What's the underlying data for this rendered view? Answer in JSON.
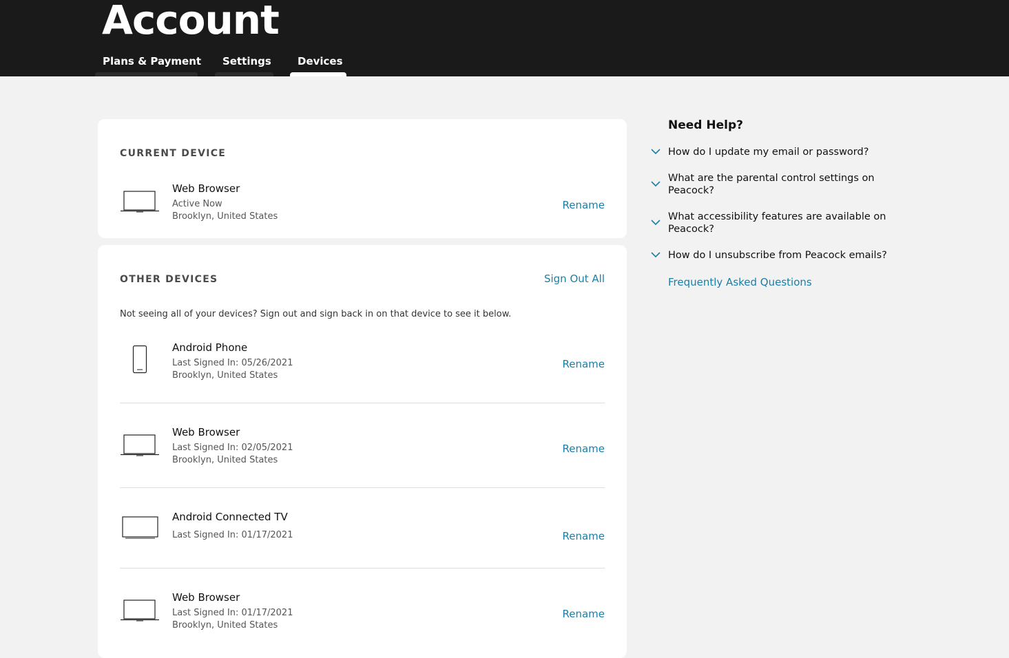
{
  "header": {
    "title": "Account",
    "tabs": [
      {
        "label": "Plans & Payment"
      },
      {
        "label": "Settings"
      },
      {
        "label": "Devices"
      }
    ]
  },
  "current_device": {
    "section_title": "CURRENT DEVICE",
    "device": {
      "name": "Web Browser",
      "status": "Active Now",
      "location": "Brooklyn, United States",
      "icon": "laptop-icon"
    },
    "rename_label": "Rename"
  },
  "other_devices": {
    "section_title": "OTHER DEVICES",
    "sign_out_all_label": "Sign Out All",
    "notice": "Not seeing all of your devices? Sign out and sign back in on that device to see it below.",
    "rename_label": "Rename",
    "devices": [
      {
        "name": "Android Phone",
        "status": "Last Signed In: 05/26/2021",
        "location": "Brooklyn, United States",
        "icon": "phone-icon"
      },
      {
        "name": "Web Browser",
        "status": "Last Signed In: 02/05/2021",
        "location": "Brooklyn, United States",
        "icon": "laptop-icon"
      },
      {
        "name": "Android Connected TV",
        "status": "Last Signed In: 01/17/2021",
        "location": "",
        "icon": "tv-icon"
      },
      {
        "name": "Web Browser",
        "status": "Last Signed In: 01/17/2021",
        "location": "Brooklyn, United States",
        "icon": "laptop-icon"
      }
    ]
  },
  "help": {
    "title": "Need Help?",
    "questions": [
      {
        "text": "How do I update my email or password?"
      },
      {
        "text": "What are the parental control settings on Peacock?"
      },
      {
        "text": "What accessibility features are available on Peacock?"
      },
      {
        "text": "How do I unsubscribe from Peacock emails?"
      }
    ],
    "faq_link": "Frequently Asked Questions"
  },
  "colors": {
    "header_bg": "#1a1a1a",
    "page_bg": "#f2f2f2",
    "link": "#1a7fa8"
  }
}
